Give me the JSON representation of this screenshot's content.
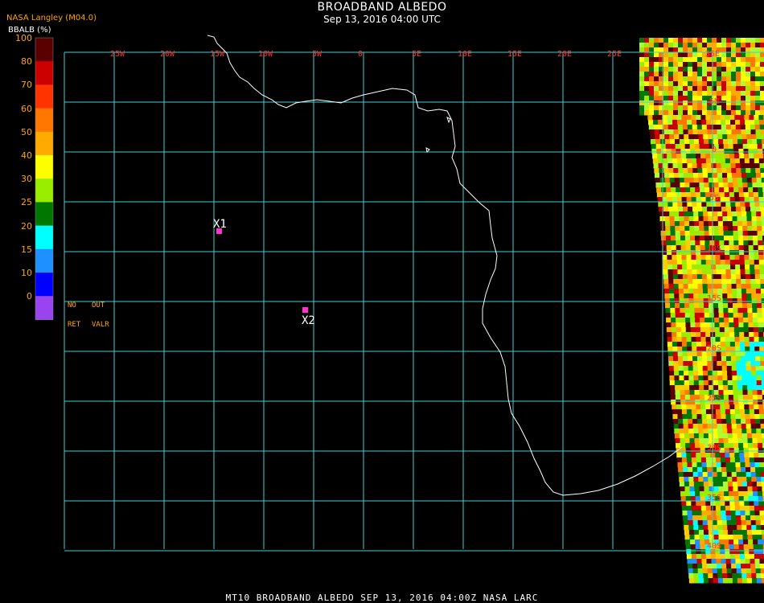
{
  "header": {
    "title": "BROADBAND ALBEDO",
    "subtitle": "Sep 13, 2016 04:00 UTC",
    "source": "NASA Langley (M04.0)",
    "unit_label": "BBALB (%)"
  },
  "colorbar": {
    "ticks": [
      "100",
      "80",
      "70",
      "60",
      "50",
      "40",
      "30",
      "25",
      "20",
      "15",
      "10",
      "0"
    ],
    "colors": [
      "#5a0000",
      "#cc0000",
      "#ff3300",
      "#ff7700",
      "#ffaa00",
      "#ffff00",
      "#99ee00",
      "#007700",
      "#00ffff",
      "#1e90ff",
      "#0000ff",
      "#9944ee"
    ]
  },
  "legend_notes": {
    "no": "NO",
    "out": "OUT",
    "ret": "RET",
    "valr": "VALR",
    "no_color": "#ffffff",
    "out_color": "#000000"
  },
  "grid": {
    "lon_labels": [
      "25W",
      "20W",
      "15W",
      "10W",
      "5W",
      "0",
      "5E",
      "10E",
      "15E",
      "20E",
      "25E",
      "35E"
    ],
    "lat_labels": [
      "5N",
      "0",
      "5S",
      "10S",
      "15S",
      "20S",
      "25S",
      "30S",
      "35S",
      "40S"
    ],
    "line_color": "#40d0d0",
    "label_color": "#ff3333"
  },
  "markers": [
    {
      "label": "X1",
      "color": "#ff33cc"
    },
    {
      "label": "X2",
      "color": "#ff33cc"
    }
  ],
  "footer": "MT10  BROADBAND ALBEDO   SEP 13, 2016 04:00Z   NASA LARC"
}
